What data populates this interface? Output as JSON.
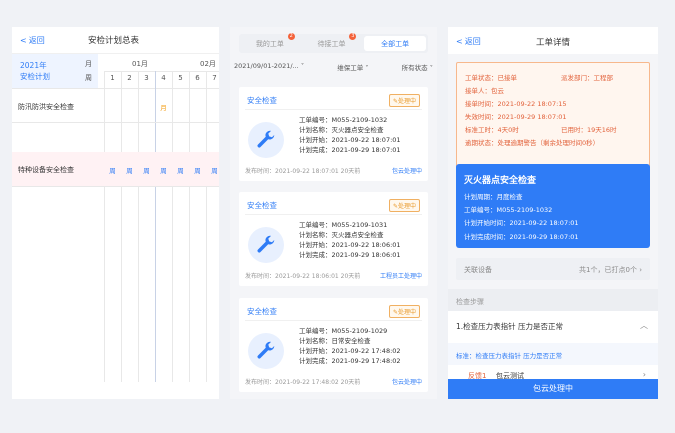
{
  "plan": {
    "back_label": "返回",
    "title": "安检计划总表",
    "year": "2021年",
    "subtitle": "安检计划",
    "month_label": "月",
    "week_label": "周",
    "months": [
      "01月",
      "02月"
    ],
    "weeks": [
      "1",
      "2",
      "3",
      "4",
      "5",
      "6",
      "7"
    ],
    "rows": [
      {
        "label": "防汛防洪安全检查",
        "cells": [
          "",
          "",
          "",
          "月",
          "",
          "",
          ""
        ]
      },
      {
        "label": "特种设备安全检查",
        "cells": [
          "周",
          "周",
          "周",
          "周",
          "周",
          "周",
          "周"
        ]
      }
    ]
  },
  "orders": {
    "tabs": [
      {
        "label": "我的工单",
        "badge": "2"
      },
      {
        "label": "待接工单",
        "badge": "3"
      },
      {
        "label": "全部工单",
        "badge": ""
      }
    ],
    "filters": {
      "date": "2021/09/01-2021/...",
      "type": "维保工单",
      "status": "所有状态"
    },
    "field_labels": {
      "no": "工单编号：",
      "name": "计划名称：",
      "start": "计划开始：",
      "end": "计划完成："
    },
    "cards": [
      {
        "title": "安全检查",
        "status": "处理中",
        "no": "M055-2109-1032",
        "name": "灭火器点安全检查",
        "start": "2021-09-22 18:07:01",
        "end": "2021-09-29 18:07:01",
        "published": "发布时间：2021-09-22 18:07:01 20天前",
        "action": "包云处理中"
      },
      {
        "title": "安全检查",
        "status": "处理中",
        "no": "M055-2109-1031",
        "name": "灭火器点安全检查",
        "start": "2021-09-22 18:06:01",
        "end": "2021-09-29 18:06:01",
        "published": "发布时间：2021-09-22 18:06:01 20天前",
        "action": "工程员工处理中"
      },
      {
        "title": "安全检查",
        "status": "处理中",
        "no": "M055-2109-1029",
        "name": "日常安全检查",
        "start": "2021-09-22 17:48:02",
        "end": "2021-09-29 17:48:02",
        "published": "发布时间：2021-09-22 17:48:02 20天前",
        "action": "包云处理中"
      }
    ]
  },
  "detail": {
    "back_label": "返回",
    "title": "工单详情",
    "warn": {
      "status": "工单状态：已接单",
      "dept": "派发部门：工程部",
      "receiver": "接单人：包云",
      "receive_time": "接单时间：2021-09-22 18:07:15",
      "expire_time": "失效时间：2021-09-29 18:07:01",
      "std_hours": "标准工时：4天0时",
      "used": "已用时：19天16时",
      "overdue": "逾期状态：处理逾期警告（剩余处理时间0秒）"
    },
    "task": {
      "title": "灭火器点安全检查",
      "period": "计划周期：月度检查",
      "no": "工单编号：M055-2109-1032",
      "start": "计划开始时间：2021-09-22 18:07:01",
      "end": "计划完成时间：2021-09-29 18:07:01"
    },
    "device_label": "关联设备",
    "device_count": "共1个，已打点0个",
    "steps_label": "检查步骤",
    "step_title": "1.检查压力表指针 压力是否正常",
    "standard": "标准：检查压力表指针 压力是否正常",
    "feedback_tag": "反馈1",
    "feedback_value": "包云测试",
    "submit_label": "包云处理中"
  }
}
